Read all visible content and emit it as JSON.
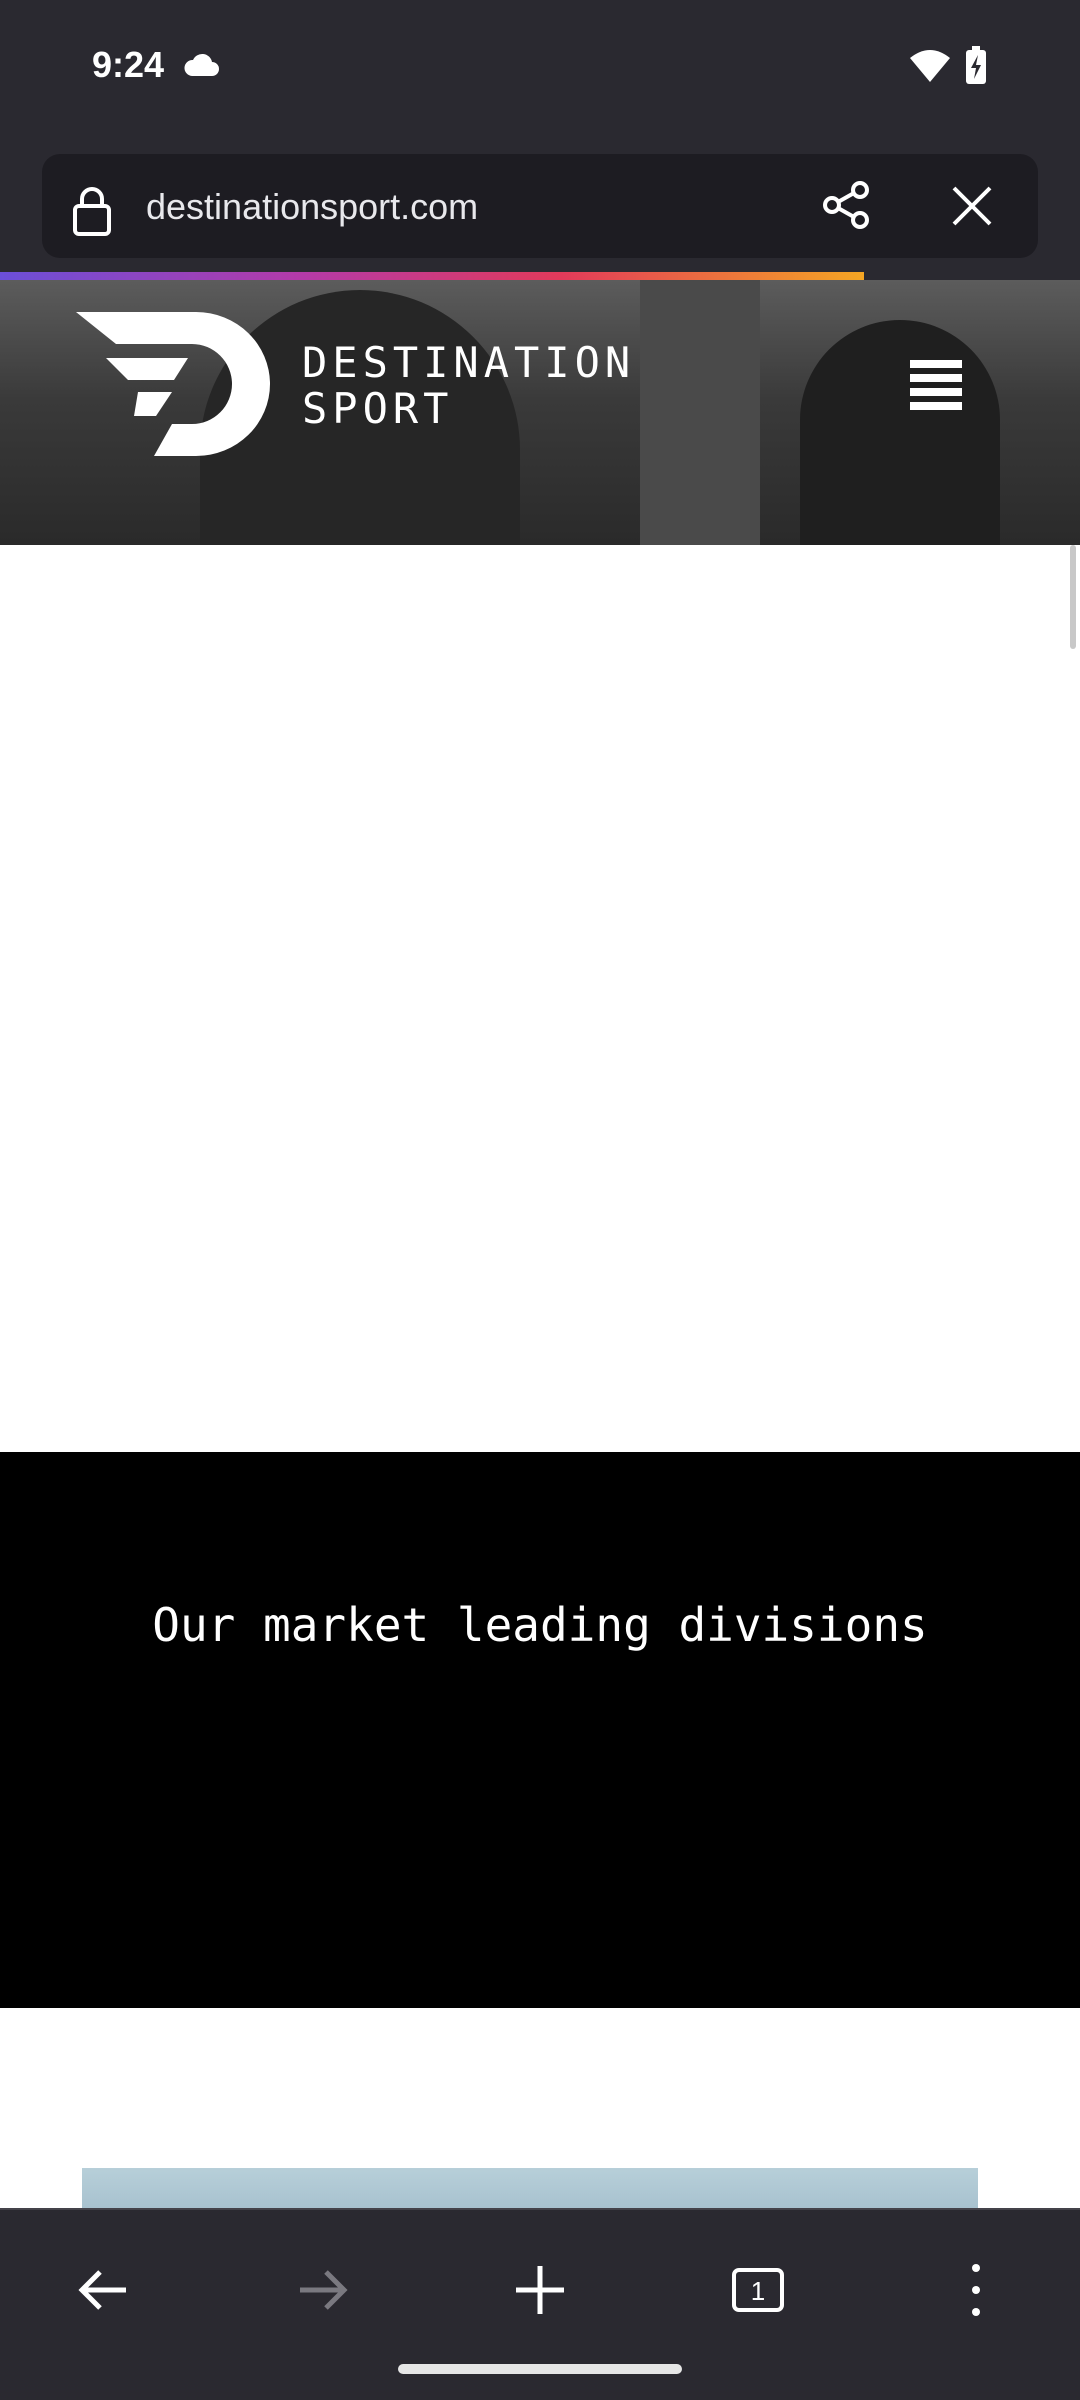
{
  "status_bar": {
    "time": "9:24",
    "icons": [
      "cloud-icon",
      "wifi-icon",
      "battery-charging-icon"
    ]
  },
  "browser": {
    "url": "destinationsport.com",
    "icons": [
      "lock-icon",
      "share-icon",
      "close-icon"
    ],
    "page_load_progress": 0.8
  },
  "header": {
    "brand_line1": "DESTINATION",
    "brand_line2": "SPORT",
    "icons": [
      "logo-icon",
      "hamburger-menu-icon"
    ]
  },
  "divisions": {
    "heading": "Our market leading divisions"
  },
  "toolbar": {
    "icons": [
      "back-arrow-icon",
      "forward-arrow-icon",
      "plus-icon",
      "tabs-icon",
      "more-vert-icon"
    ],
    "tab_count": "1"
  },
  "colors": {
    "chrome_bg": "#2a2930",
    "url_field_bg": "#1d1c22",
    "section_black": "#000000",
    "page_bg": "#ffffff"
  }
}
